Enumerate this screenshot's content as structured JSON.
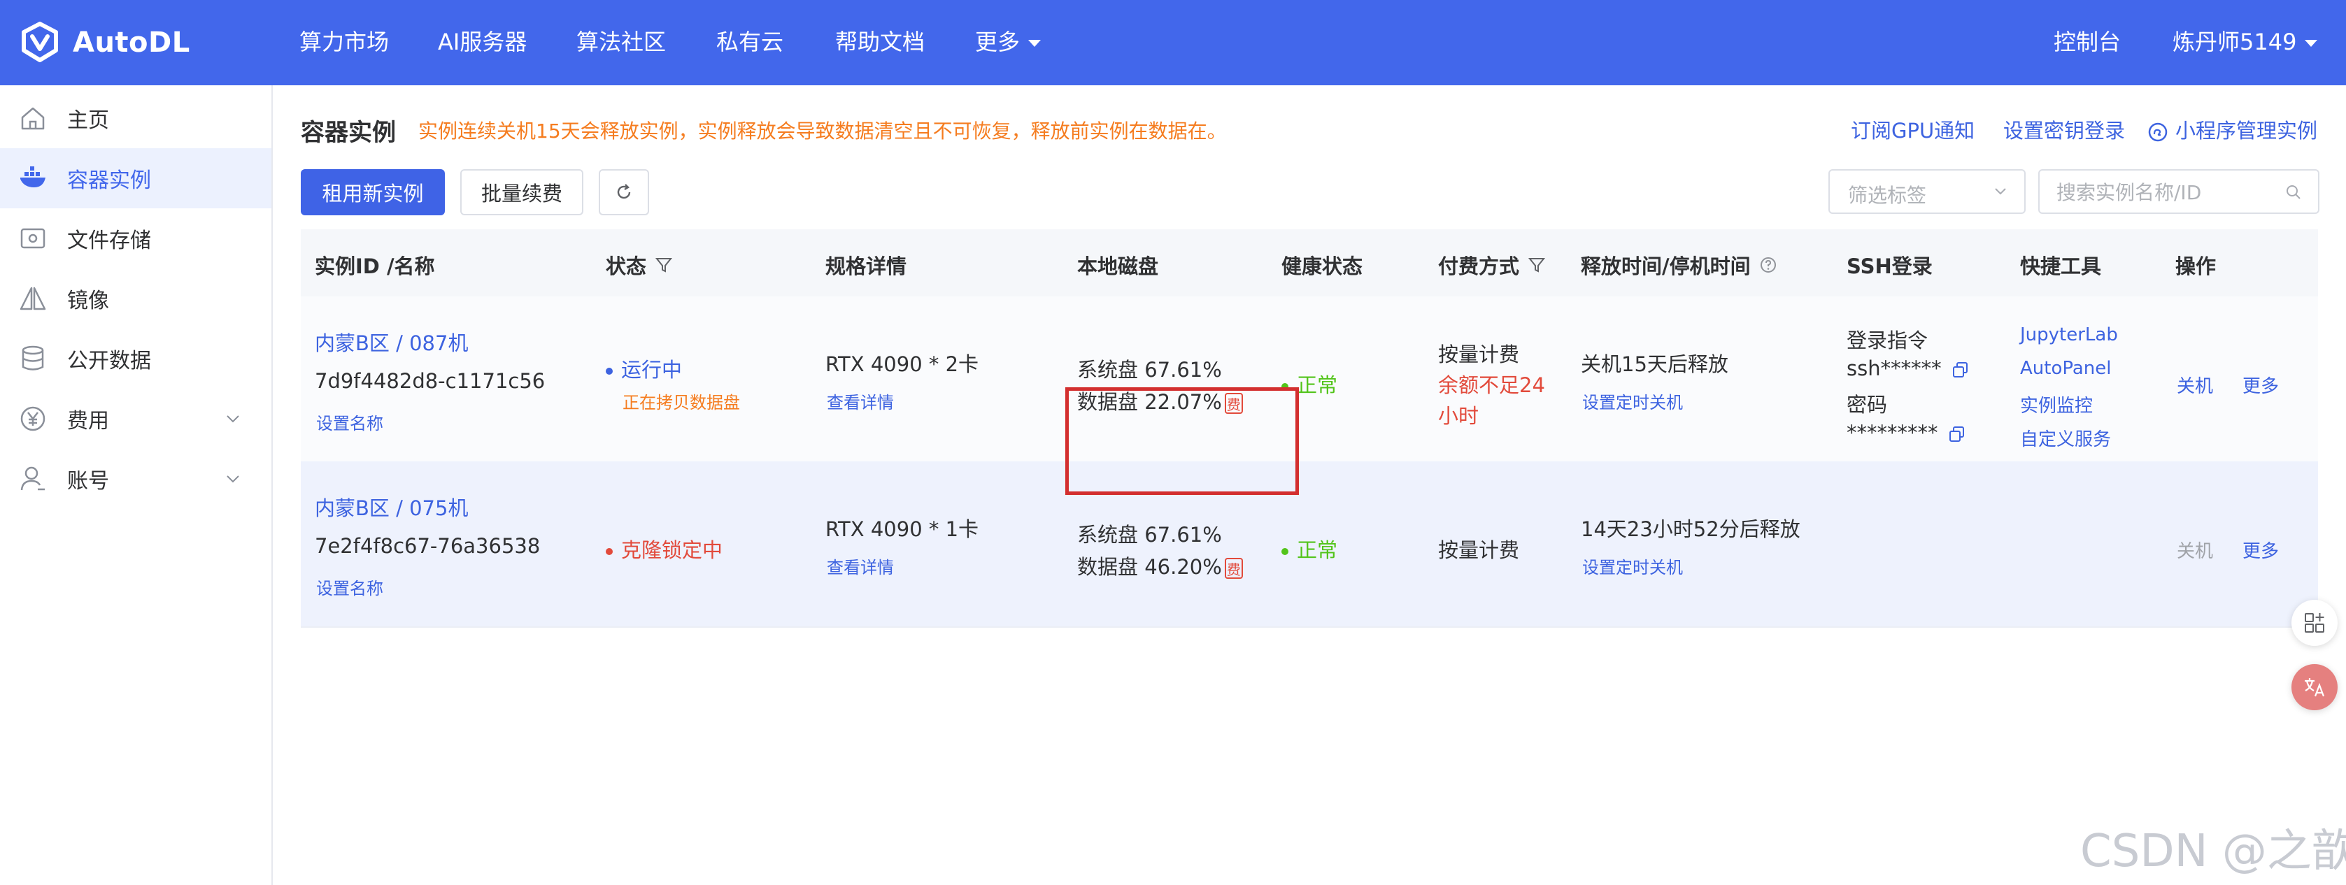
{
  "app": {
    "name": "AutoDL",
    "brand_color": "#4267eb"
  },
  "topnav": {
    "items": [
      "算力市场",
      "AI服务器",
      "算法社区",
      "私有云",
      "帮助文档",
      "更多"
    ],
    "console": "控制台",
    "user": "炼丹师5149"
  },
  "sidebar": {
    "items": [
      {
        "label": "主页",
        "icon": "home-icon"
      },
      {
        "label": "容器实例",
        "icon": "container-icon",
        "active": true
      },
      {
        "label": "文件存储",
        "icon": "storage-icon"
      },
      {
        "label": "镜像",
        "icon": "image-icon"
      },
      {
        "label": "公开数据",
        "icon": "database-icon"
      },
      {
        "label": "费用",
        "icon": "yen-icon",
        "expandable": true
      },
      {
        "label": "账号",
        "icon": "user-icon",
        "expandable": true
      }
    ]
  },
  "page": {
    "title": "容器实例",
    "warning": "实例连续关机15天会释放实例，实例释放会导致数据清空且不可恢复，释放前实例在数据在。",
    "links": [
      "订阅GPU通知",
      "设置密钥登录",
      "小程序管理实例"
    ],
    "buttons": {
      "rent": "租用新实例",
      "renew": "批量续费"
    },
    "filter_placeholder": "筛选标签",
    "search_placeholder": "搜索实例名称/ID"
  },
  "table": {
    "headers": [
      "实例ID /名称",
      "状态",
      "规格详情",
      "本地磁盘",
      "健康状态",
      "付费方式",
      "释放时间/停机时间",
      "SSH登录",
      "快捷工具",
      "操作"
    ],
    "rows": [
      {
        "region": "内蒙B区 / 087机",
        "id": "7d9f4482d8-c1171c56",
        "set_name": "设置名称",
        "status": "运行中",
        "status_sub": "正在拷贝数据盘",
        "spec": "RTX 4090 * 2卡",
        "spec_link": "查看详情",
        "sys_disk": "系统盘 67.61%",
        "data_disk": "数据盘 22.07%",
        "fee_badge": "费",
        "health": "正常",
        "billing": "按量计费",
        "billing_warn": [
          "余额不足24",
          "小时"
        ],
        "release": "关机15天后释放",
        "timer": "设置定时关机",
        "ssh_cmd_label": "登录指令",
        "ssh_cmd": "ssh******",
        "ssh_pwd_label": "密码",
        "ssh_pwd": "*********",
        "tools": [
          "JupyterLab",
          "AutoPanel",
          "实例监控",
          "自定义服务"
        ],
        "op_shutdown": "关机",
        "op_more": "更多"
      },
      {
        "region": "内蒙B区 / 075机",
        "id": "7e2f4f8c67-76a36538",
        "set_name": "设置名称",
        "status": "克隆锁定中",
        "spec": "RTX 4090 * 1卡",
        "spec_link": "查看详情",
        "sys_disk": "系统盘 67.61%",
        "data_disk": "数据盘 46.20%",
        "fee_badge": "费",
        "health": "正常",
        "billing": "按量计费",
        "release": "14天23小时52分后释放",
        "timer": "设置定时关机",
        "op_shutdown": "关机",
        "op_more": "更多"
      }
    ]
  },
  "watermark": "CSDN @之歆",
  "colors": {
    "link": "#3d63e0",
    "warning": "#f57c1f",
    "danger": "#e24a3b",
    "success": "#52c41a",
    "highlight_frame": "#d32f2f"
  }
}
